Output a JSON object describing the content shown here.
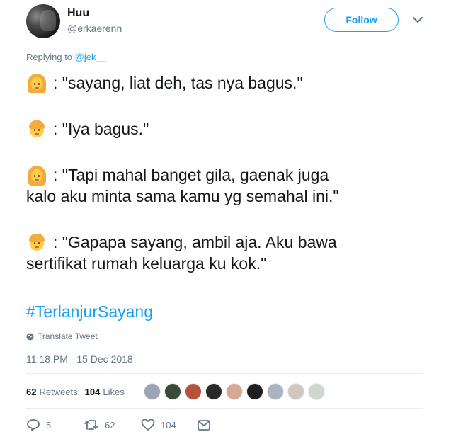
{
  "user": {
    "name": "Huu",
    "handle": "@erkaerenn",
    "follow_label": "Follow"
  },
  "replying": {
    "prefix": "Replying to",
    "mention": "@jek__"
  },
  "tweet": {
    "lines": [
      ": \"sayang, liat deh, tas nya bagus.\"",
      ": \"Iya bagus.\"",
      ": \"Tapi mahal banget gila, gaenak juga",
      "kalo aku minta sama kamu yg semahal ini.\"",
      ": \"Gapapa sayang, ambil aja. Aku bawa",
      "sertifikat rumah keluarga ku kok.\""
    ],
    "hashtag": "#TerlanjurSayang"
  },
  "translate_label": "Translate Tweet",
  "timestamp": "11:18 PM - 15 Dec 2018",
  "stats": {
    "retweets_count": "62",
    "retweets_label": "Retweets",
    "likes_count": "104",
    "likes_label": "Likes"
  },
  "liker_colors": [
    "#9aa5b1",
    "#3d4a3a",
    "#b5523c",
    "#2a2a2a",
    "#d9a892",
    "#1f1f1f",
    "#a9b4bf",
    "#d0c8bc",
    "#cfd8cc"
  ],
  "actions": {
    "replies": "5",
    "retweets": "62",
    "likes": "104"
  },
  "colors": {
    "accent": "#1da1f2",
    "muted": "#657786"
  }
}
